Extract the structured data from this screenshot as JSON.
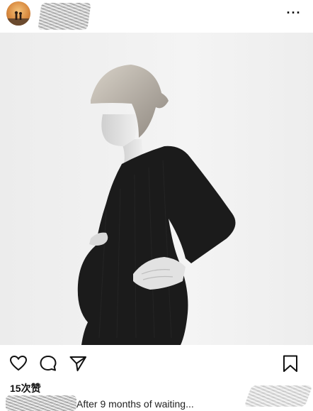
{
  "header": {
    "more_icon": "more-horizontal-icon",
    "more_label": "···"
  },
  "actions": {
    "like_icon": "heart-icon",
    "comment_icon": "comment-icon",
    "share_icon": "send-icon",
    "save_icon": "bookmark-icon"
  },
  "likes": {
    "text": "15次赞"
  },
  "caption": {
    "text": "After 9 months of waiting..."
  }
}
